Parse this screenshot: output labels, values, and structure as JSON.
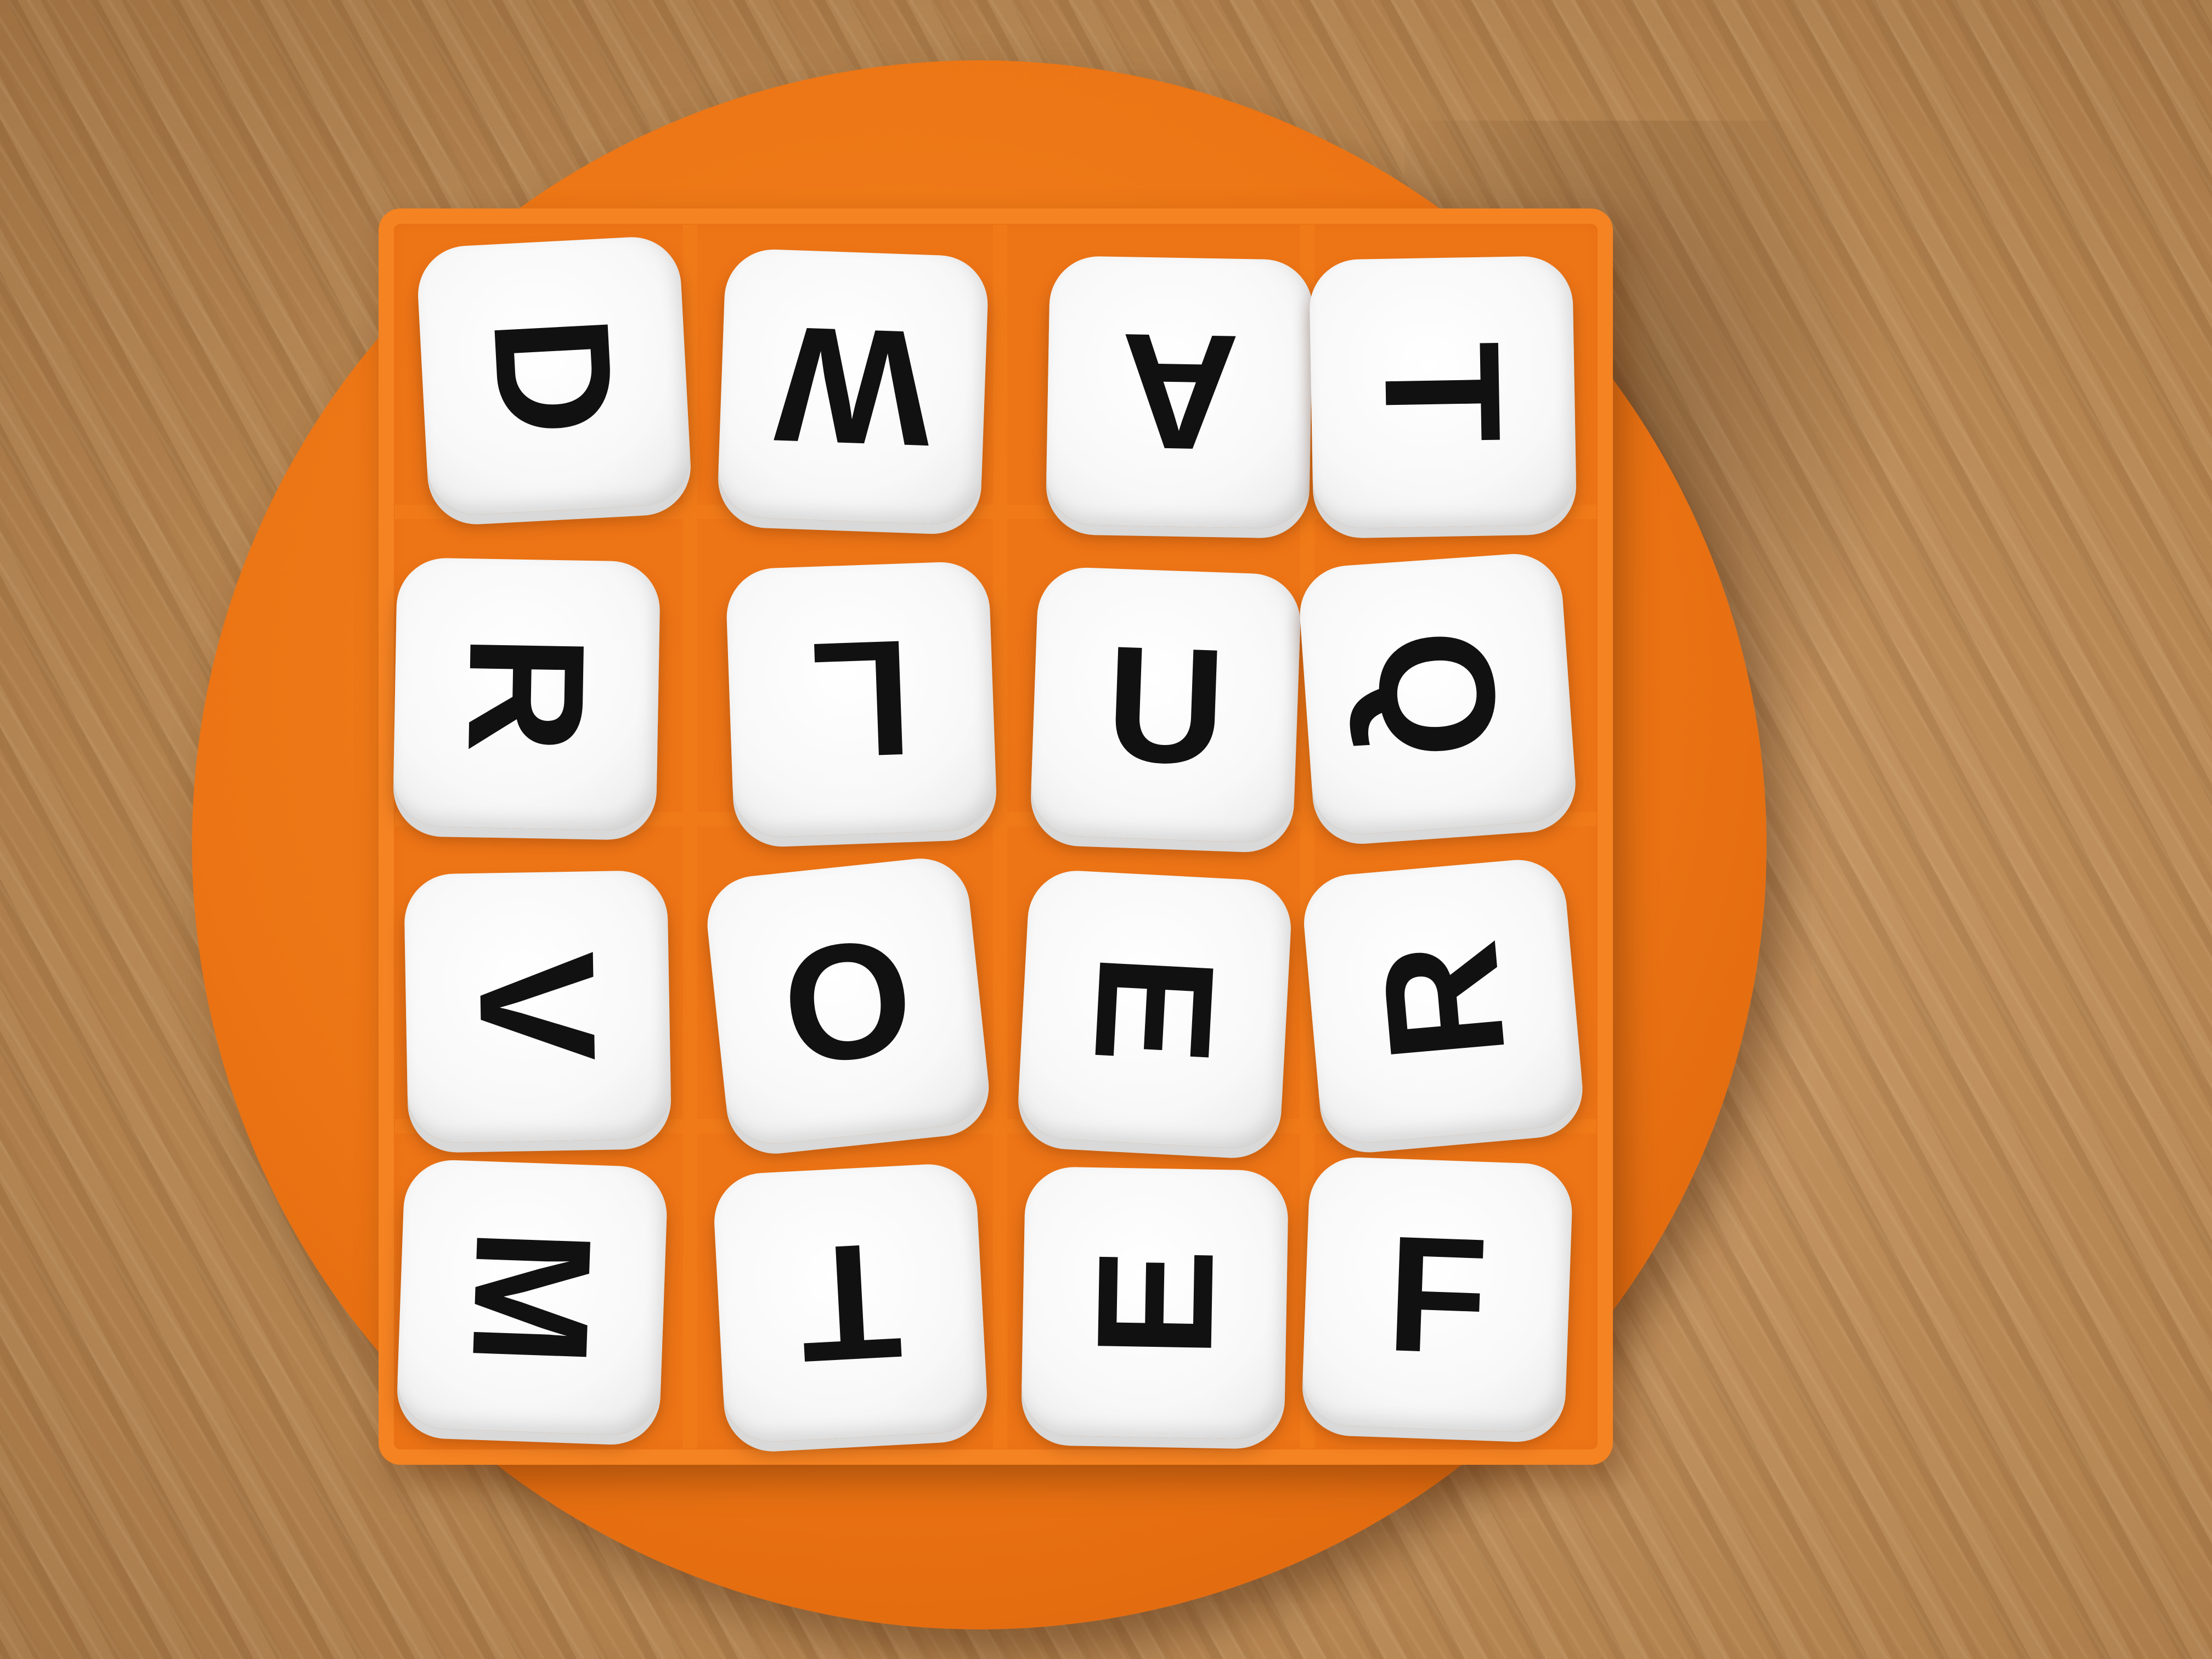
{
  "board": {
    "rows": [
      [
        {
          "letter": "D",
          "rotation": 90
        },
        {
          "letter": "W",
          "rotation": 180
        },
        {
          "letter": "A",
          "rotation": 180
        },
        {
          "letter": "T",
          "rotation": 90
        }
      ],
      [
        {
          "letter": "R",
          "rotation": 90
        },
        {
          "letter": "L",
          "rotation": 180
        },
        {
          "letter": "U",
          "rotation": 0
        },
        {
          "letter": "Q",
          "rotation": 90
        }
      ],
      [
        {
          "letter": "V",
          "rotation": 90
        },
        {
          "letter": "O",
          "rotation": 0
        },
        {
          "letter": "E",
          "rotation": 90
        },
        {
          "letter": "R",
          "rotation": 270
        }
      ],
      [
        {
          "letter": "M",
          "rotation": 90
        },
        {
          "letter": "T",
          "rotation": 180
        },
        {
          "letter": "E",
          "rotation": 270
        },
        {
          "letter": "F",
          "rotation": 0
        }
      ]
    ]
  },
  "colors": {
    "tray": "#ee7516",
    "die_face": "#ffffff",
    "letter": "#111111",
    "table": "#b98a5c"
  }
}
